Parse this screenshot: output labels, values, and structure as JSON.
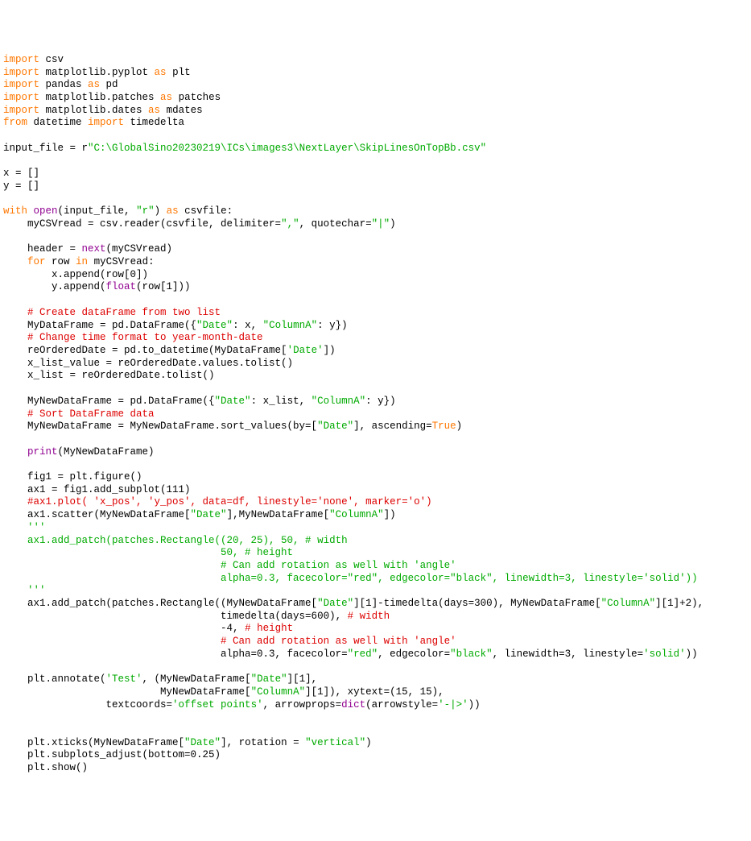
{
  "lines": [
    [
      {
        "t": "import",
        "c": "kw-orange"
      },
      {
        "t": " csv",
        "c": ""
      }
    ],
    [
      {
        "t": "import",
        "c": "kw-orange"
      },
      {
        "t": " matplotlib.pyplot ",
        "c": ""
      },
      {
        "t": "as",
        "c": "kw-orange"
      },
      {
        "t": " plt",
        "c": ""
      }
    ],
    [
      {
        "t": "import",
        "c": "kw-orange"
      },
      {
        "t": " pandas ",
        "c": ""
      },
      {
        "t": "as",
        "c": "kw-orange"
      },
      {
        "t": " pd",
        "c": ""
      }
    ],
    [
      {
        "t": "import",
        "c": "kw-orange"
      },
      {
        "t": " matplotlib.patches ",
        "c": ""
      },
      {
        "t": "as",
        "c": "kw-orange"
      },
      {
        "t": " patches",
        "c": ""
      }
    ],
    [
      {
        "t": "import",
        "c": "kw-orange"
      },
      {
        "t": " matplotlib.dates ",
        "c": ""
      },
      {
        "t": "as",
        "c": "kw-orange"
      },
      {
        "t": " mdates",
        "c": ""
      }
    ],
    [
      {
        "t": "from",
        "c": "kw-orange"
      },
      {
        "t": " datetime ",
        "c": ""
      },
      {
        "t": "import",
        "c": "kw-orange"
      },
      {
        "t": " timedelta",
        "c": ""
      }
    ],
    [
      {
        "t": "",
        "c": ""
      }
    ],
    [
      {
        "t": "input_file = r",
        "c": ""
      },
      {
        "t": "\"C:\\GlobalSino20230219\\ICs\\images3\\NextLayer\\SkipLinesOnTopBb.csv\"",
        "c": "str-green"
      }
    ],
    [
      {
        "t": "",
        "c": ""
      }
    ],
    [
      {
        "t": "x = []",
        "c": ""
      }
    ],
    [
      {
        "t": "y = []",
        "c": ""
      }
    ],
    [
      {
        "t": "",
        "c": ""
      }
    ],
    [
      {
        "t": "with",
        "c": "kw-orange"
      },
      {
        "t": " ",
        "c": ""
      },
      {
        "t": "open",
        "c": "name-purple"
      },
      {
        "t": "(input_file, ",
        "c": ""
      },
      {
        "t": "\"r\"",
        "c": "str-green"
      },
      {
        "t": ") ",
        "c": ""
      },
      {
        "t": "as",
        "c": "kw-orange"
      },
      {
        "t": " csvfile:",
        "c": ""
      }
    ],
    [
      {
        "t": "    myCSVread = csv.reader(csvfile, delimiter=",
        "c": ""
      },
      {
        "t": "\",\"",
        "c": "str-green"
      },
      {
        "t": ", quotechar=",
        "c": ""
      },
      {
        "t": "\"|\"",
        "c": "str-green"
      },
      {
        "t": ")",
        "c": ""
      }
    ],
    [
      {
        "t": "",
        "c": ""
      }
    ],
    [
      {
        "t": "    header = ",
        "c": ""
      },
      {
        "t": "next",
        "c": "name-purple"
      },
      {
        "t": "(myCSVread)",
        "c": ""
      }
    ],
    [
      {
        "t": "    ",
        "c": ""
      },
      {
        "t": "for",
        "c": "kw-orange"
      },
      {
        "t": " row ",
        "c": ""
      },
      {
        "t": "in",
        "c": "kw-orange"
      },
      {
        "t": " myCSVread:",
        "c": ""
      }
    ],
    [
      {
        "t": "        x.append(row[0])",
        "c": ""
      }
    ],
    [
      {
        "t": "        y.append(",
        "c": ""
      },
      {
        "t": "float",
        "c": "name-purple"
      },
      {
        "t": "(row[1]))",
        "c": ""
      }
    ],
    [
      {
        "t": "",
        "c": ""
      }
    ],
    [
      {
        "t": "    ",
        "c": ""
      },
      {
        "t": "# Create dataFrame from two list",
        "c": "comment"
      }
    ],
    [
      {
        "t": "    MyDataFrame = pd.DataFrame({",
        "c": ""
      },
      {
        "t": "\"Date\"",
        "c": "str-green"
      },
      {
        "t": ": x, ",
        "c": ""
      },
      {
        "t": "\"ColumnA\"",
        "c": "str-green"
      },
      {
        "t": ": y})",
        "c": ""
      }
    ],
    [
      {
        "t": "    ",
        "c": ""
      },
      {
        "t": "# Change time format to year-month-date",
        "c": "comment"
      }
    ],
    [
      {
        "t": "    reOrderedDate = pd.to_datetime(MyDataFrame[",
        "c": ""
      },
      {
        "t": "'Date'",
        "c": "str-green"
      },
      {
        "t": "])",
        "c": ""
      }
    ],
    [
      {
        "t": "    x_list_value = reOrderedDate.values.tolist()",
        "c": ""
      }
    ],
    [
      {
        "t": "    x_list = reOrderedDate.tolist()",
        "c": ""
      }
    ],
    [
      {
        "t": "",
        "c": ""
      }
    ],
    [
      {
        "t": "    MyNewDataFrame = pd.DataFrame({",
        "c": ""
      },
      {
        "t": "\"Date\"",
        "c": "str-green"
      },
      {
        "t": ": x_list, ",
        "c": ""
      },
      {
        "t": "\"ColumnA\"",
        "c": "str-green"
      },
      {
        "t": ": y})",
        "c": ""
      }
    ],
    [
      {
        "t": "    ",
        "c": ""
      },
      {
        "t": "# Sort DataFrame data",
        "c": "comment"
      }
    ],
    [
      {
        "t": "    MyNewDataFrame = MyNewDataFrame.sort_values(by=[",
        "c": ""
      },
      {
        "t": "\"Date\"",
        "c": "str-green"
      },
      {
        "t": "], ascending=",
        "c": ""
      },
      {
        "t": "True",
        "c": "kw-orange"
      },
      {
        "t": ")",
        "c": ""
      }
    ],
    [
      {
        "t": "",
        "c": ""
      }
    ],
    [
      {
        "t": "    ",
        "c": ""
      },
      {
        "t": "print",
        "c": "name-purple"
      },
      {
        "t": "(MyNewDataFrame)",
        "c": ""
      }
    ],
    [
      {
        "t": "",
        "c": ""
      }
    ],
    [
      {
        "t": "    fig1 = plt.figure()",
        "c": ""
      }
    ],
    [
      {
        "t": "    ax1 = fig1.add_subplot(111)",
        "c": ""
      }
    ],
    [
      {
        "t": "    ",
        "c": ""
      },
      {
        "t": "#ax1.plot( 'x_pos', 'y_pos', data=df, linestyle='none', marker='o')",
        "c": "comment"
      }
    ],
    [
      {
        "t": "    ax1.scatter(MyNewDataFrame[",
        "c": ""
      },
      {
        "t": "\"Date\"",
        "c": "str-green"
      },
      {
        "t": "],MyNewDataFrame[",
        "c": ""
      },
      {
        "t": "\"ColumnA\"",
        "c": "str-green"
      },
      {
        "t": "])",
        "c": ""
      }
    ],
    [
      {
        "t": "    ",
        "c": ""
      },
      {
        "t": "'''",
        "c": "str-green"
      }
    ],
    [
      {
        "t": "    ax1.add_patch(patches.Rectangle((20, 25), 50, # width",
        "c": "str-green"
      }
    ],
    [
      {
        "t": "                                    50, # height",
        "c": "str-green"
      }
    ],
    [
      {
        "t": "                                    # Can add rotation as well with 'angle'",
        "c": "str-green"
      }
    ],
    [
      {
        "t": "                                    alpha=0.3, facecolor=\"red\", edgecolor=\"black\", linewidth=3, linestyle='solid'))",
        "c": "str-green"
      }
    ],
    [
      {
        "t": "    '''",
        "c": "str-green"
      }
    ],
    [
      {
        "t": "    ax1.add_patch(patches.Rectangle((MyNewDataFrame[",
        "c": ""
      },
      {
        "t": "\"Date\"",
        "c": "str-green"
      },
      {
        "t": "][1]-timedelta(days=300), MyNewDataFrame[",
        "c": ""
      },
      {
        "t": "\"ColumnA\"",
        "c": "str-green"
      },
      {
        "t": "][1]+2),",
        "c": ""
      }
    ],
    [
      {
        "t": "                                    timedelta(days=600), ",
        "c": ""
      },
      {
        "t": "# width",
        "c": "comment"
      }
    ],
    [
      {
        "t": "                                    -4, ",
        "c": ""
      },
      {
        "t": "# height",
        "c": "comment"
      }
    ],
    [
      {
        "t": "                                    ",
        "c": ""
      },
      {
        "t": "# Can add rotation as well with 'angle'",
        "c": "comment"
      }
    ],
    [
      {
        "t": "                                    alpha=0.3, facecolor=",
        "c": ""
      },
      {
        "t": "\"red\"",
        "c": "str-green"
      },
      {
        "t": ", edgecolor=",
        "c": ""
      },
      {
        "t": "\"black\"",
        "c": "str-green"
      },
      {
        "t": ", linewidth=3, linestyle=",
        "c": ""
      },
      {
        "t": "'solid'",
        "c": "str-green"
      },
      {
        "t": "))",
        "c": ""
      }
    ],
    [
      {
        "t": "",
        "c": ""
      }
    ],
    [
      {
        "t": "    plt.annotate(",
        "c": ""
      },
      {
        "t": "'Test'",
        "c": "str-green"
      },
      {
        "t": ", (MyNewDataFrame[",
        "c": ""
      },
      {
        "t": "\"Date\"",
        "c": "str-green"
      },
      {
        "t": "][1],",
        "c": ""
      }
    ],
    [
      {
        "t": "                          MyNewDataFrame[",
        "c": ""
      },
      {
        "t": "\"ColumnA\"",
        "c": "str-green"
      },
      {
        "t": "][1]), xytext=(15, 15),",
        "c": ""
      }
    ],
    [
      {
        "t": "                 textcoords=",
        "c": ""
      },
      {
        "t": "'offset points'",
        "c": "str-green"
      },
      {
        "t": ", arrowprops=",
        "c": ""
      },
      {
        "t": "dict",
        "c": "name-purple"
      },
      {
        "t": "(arrowstyle=",
        "c": ""
      },
      {
        "t": "'-|>'",
        "c": "str-green"
      },
      {
        "t": "))",
        "c": ""
      }
    ],
    [
      {
        "t": "",
        "c": ""
      }
    ],
    [
      {
        "t": "",
        "c": ""
      }
    ],
    [
      {
        "t": "    plt.xticks(MyNewDataFrame[",
        "c": ""
      },
      {
        "t": "\"Date\"",
        "c": "str-green"
      },
      {
        "t": "], rotation = ",
        "c": ""
      },
      {
        "t": "\"vertical\"",
        "c": "str-green"
      },
      {
        "t": ")",
        "c": ""
      }
    ],
    [
      {
        "t": "    plt.subplots_adjust(bottom=0.25)",
        "c": ""
      }
    ],
    [
      {
        "t": "    plt.show()",
        "c": ""
      }
    ]
  ]
}
